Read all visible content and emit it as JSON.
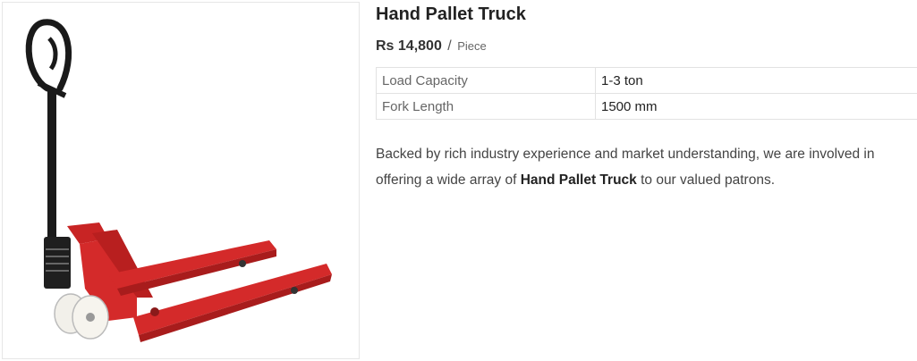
{
  "product": {
    "title": "Hand Pallet Truck",
    "price": "Rs 14,800",
    "separator": "/",
    "unit": "Piece"
  },
  "specs": [
    {
      "label": "Load Capacity",
      "value": "1-3 ton"
    },
    {
      "label": "Fork Length",
      "value": "1500 mm"
    }
  ],
  "description": {
    "before": "Backed by rich industry experience and market understanding, we are involved in offering a wide array of ",
    "bold": "Hand Pallet Truck",
    "after": " to our valued patrons."
  },
  "colors": {
    "frame_red": "#d42a2a",
    "handle_black": "#1a1a1a",
    "wheel_white": "#f2f0ea"
  }
}
